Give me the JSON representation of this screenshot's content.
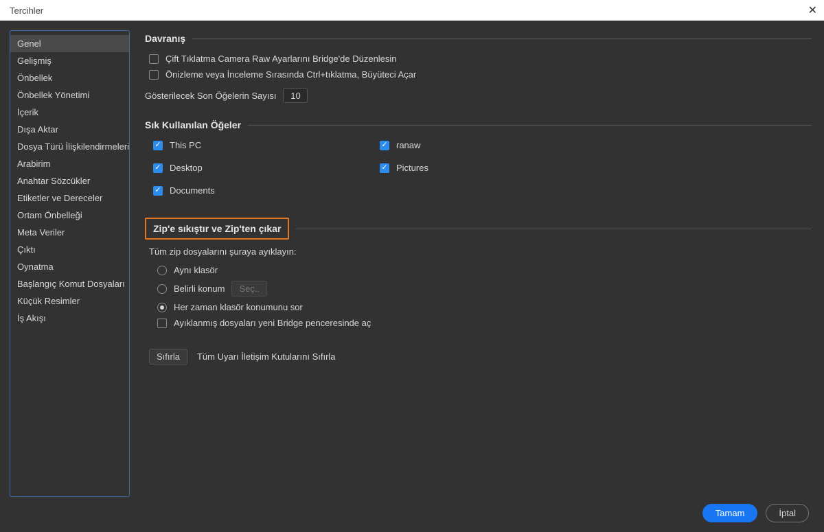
{
  "window": {
    "title": "Tercihler"
  },
  "sidebar": {
    "items": [
      "Genel",
      "Gelişmiş",
      "Önbellek",
      "Önbellek Yönetimi",
      "İçerik",
      "Dışa Aktar",
      "Dosya Türü İlişkilendirmeleri",
      "Arabirim",
      "Anahtar Sözcükler",
      "Etiketler ve Dereceler",
      "Ortam Önbelleği",
      "Meta Veriler",
      "Çıktı",
      "Oynatma",
      "Başlangıç Komut Dosyaları",
      "Küçük Resimler",
      "İş Akışı"
    ],
    "selected_index": 0
  },
  "sections": {
    "behavior": {
      "title": "Davranış",
      "opt_doubleclick": "Çift Tıklatma Camera Raw Ayarlarını Bridge'de Düzenlesin",
      "opt_ctrlclick": "Önizleme veya İnceleme Sırasında Ctrl+tıklatma, Büyüteci Açar",
      "recent_label": "Gösterilecek Son Öğelerin Sayısı",
      "recent_value": "10"
    },
    "favorites": {
      "title": "Sık Kullanılan Öğeler",
      "items": [
        "This PC",
        "ranaw",
        "Desktop",
        "Pictures",
        "Documents"
      ]
    },
    "zip": {
      "title": "Zip'e sıkıştır ve Zip'ten çıkar",
      "extract_hint": "Tüm zip dosyalarını şuraya ayıklayın:",
      "opt_same": "Aynı klasör",
      "opt_specific": "Belirli konum",
      "select_btn": "Seç..",
      "opt_ask": "Her zaman klasör konumunu sor",
      "open_new": "Ayıklanmış dosyaları yeni Bridge penceresinde aç"
    },
    "reset": {
      "button": "Sıfırla",
      "label": "Tüm Uyarı İletişim Kutularını Sıfırla"
    }
  },
  "footer": {
    "ok": "Tamam",
    "cancel": "İptal"
  }
}
